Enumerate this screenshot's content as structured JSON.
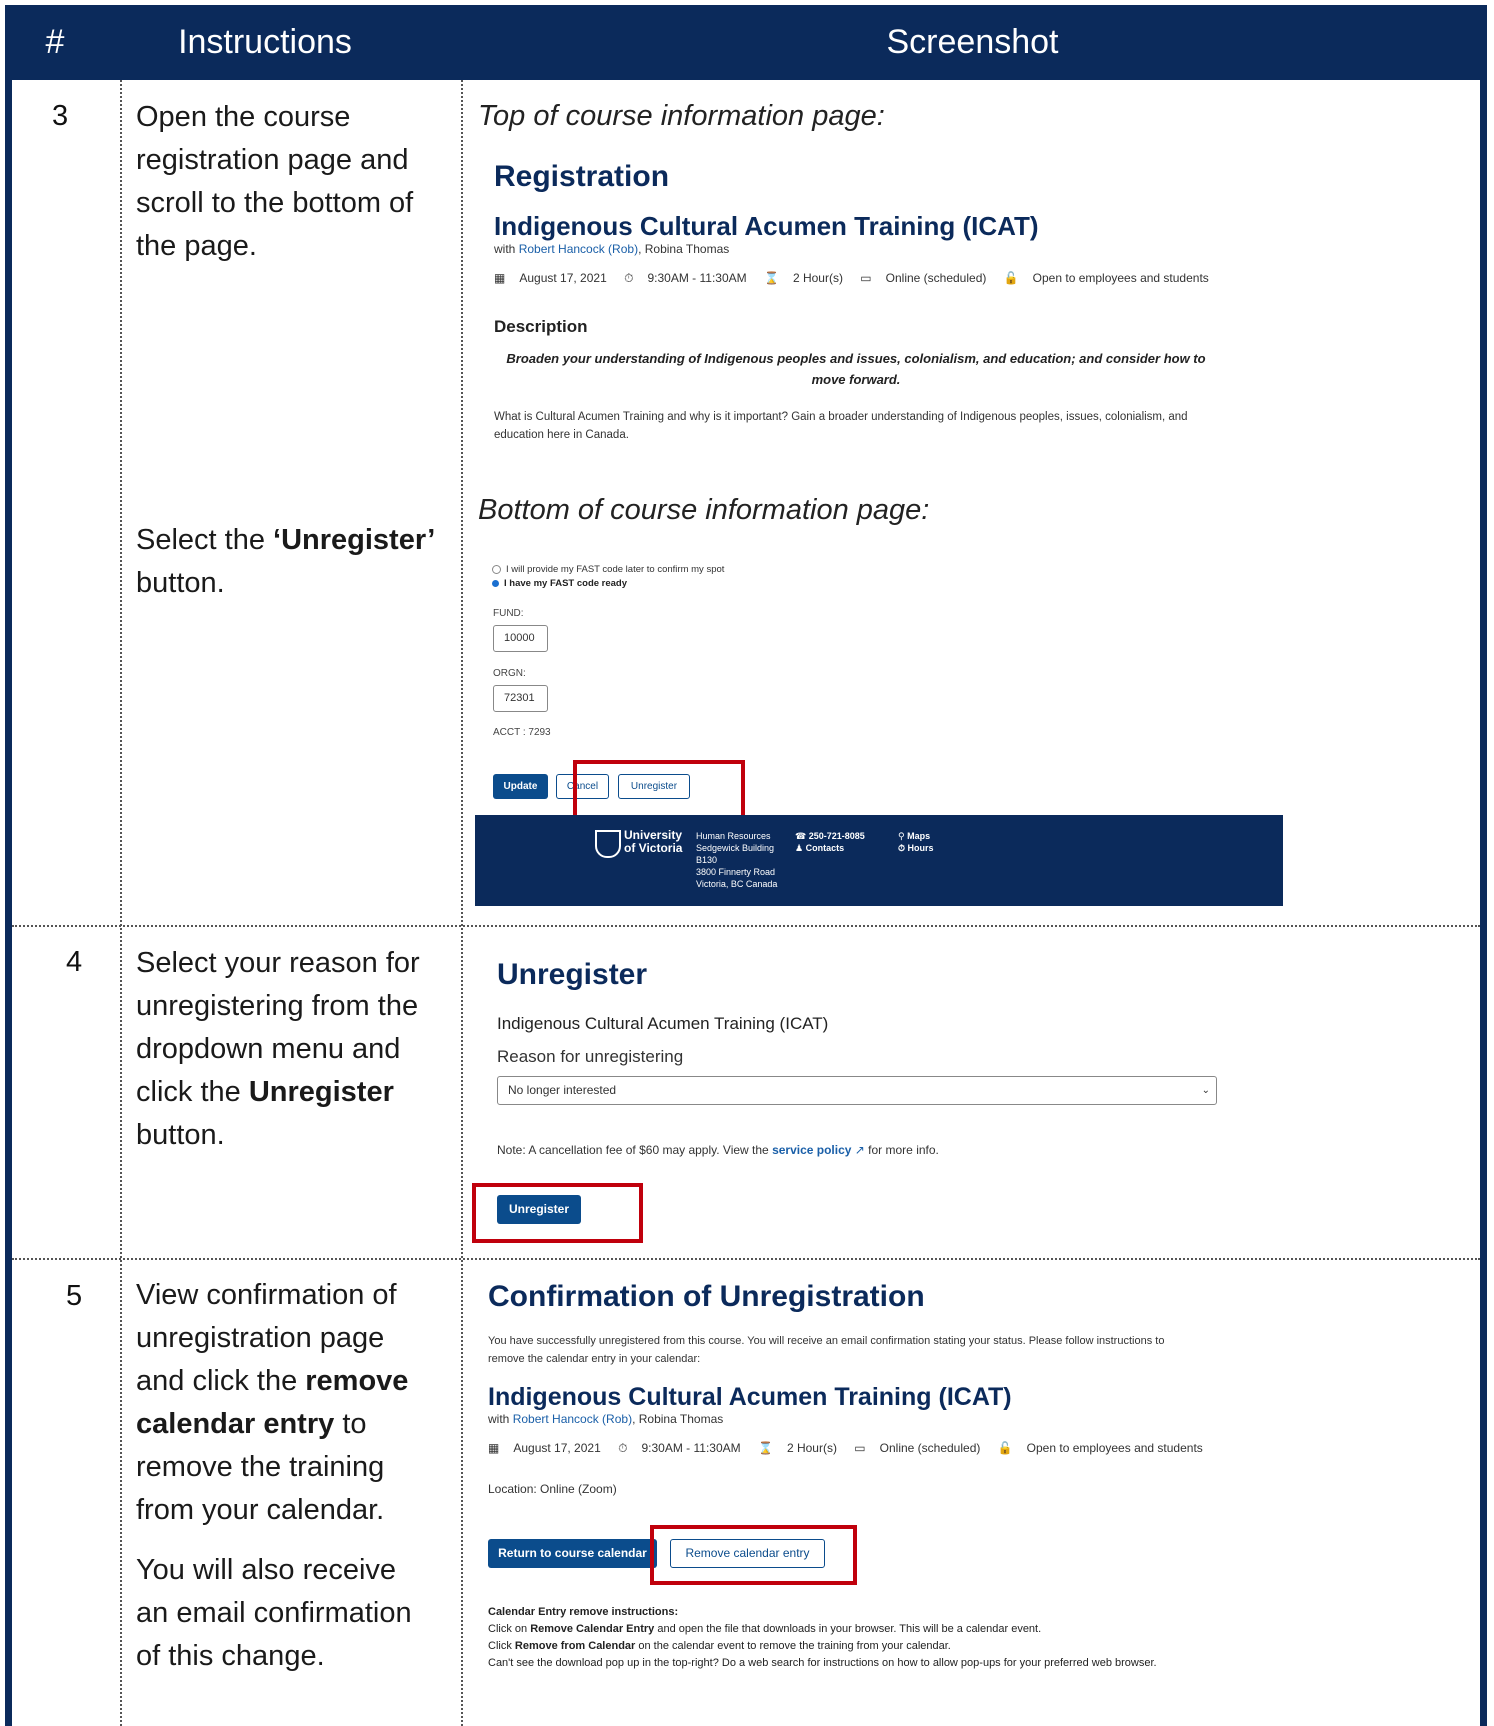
{
  "header": {
    "col_num": "#",
    "col_instructions": "Instructions",
    "col_screenshot": "Screenshot"
  },
  "step3": {
    "number": "3",
    "instr_a": "Open the course registration page and scroll to the bottom of the page.",
    "instr_b_pre": "Select the ",
    "instr_b_bold": "‘Unregister’",
    "instr_b_post": " button.",
    "caption_top": "Top of course information page:",
    "caption_bottom": "Bottom of course information page:",
    "reg_title": "Registration",
    "course_title": "Indigenous Cultural Acumen Training (ICAT)",
    "with_prefix": "with ",
    "with_link": "Robert Hancock (Rob)",
    "with_suffix": ", Robina Thomas",
    "date": "August 17, 2021",
    "time": "9:30AM - 11:30AM",
    "duration": "2 Hour(s)",
    "mode": "Online (scheduled)",
    "access": "Open to employees and students",
    "desc_heading": "Description",
    "desc_italic": "Broaden your understanding of Indigenous peoples and issues, colonialism, and education; and consider how to move forward.",
    "desc_body": "What is Cultural Acumen Training and why is it important? Gain a broader understanding of Indigenous peoples, issues, colonialism, and education here in Canada.",
    "radio_1": "I will provide my FAST code later to confirm my spot",
    "radio_2": "I have my FAST code ready",
    "fund_label": "FUND:",
    "fund_value": "10000",
    "orgn_label": "ORGN:",
    "orgn_value": "72301",
    "acct": "ACCT : 7293",
    "update_btn": "Update",
    "cancel_btn": "Cancel",
    "unregister_btn": "Unregister",
    "footer": {
      "uni_line1": "University",
      "uni_line2": "of Victoria",
      "addr": [
        "Human Resources",
        "Sedgewick Building",
        "B130",
        "3800 Finnerty Road",
        "Victoria, BC Canada"
      ],
      "phone": "250-721-8085",
      "contacts": "Contacts",
      "maps": "Maps",
      "hours": "Hours"
    }
  },
  "step4": {
    "number": "4",
    "instr_pre": "Select your reason for unregistering from the dropdown menu and click the ",
    "instr_bold": "Unregister",
    "instr_post": " button.",
    "title": "Unregister",
    "course": "Indigenous Cultural Acumen Training (ICAT)",
    "reason_label": "Reason for unregistering",
    "reason_value": "No longer interested",
    "note_pre": "Note: A cancellation fee of $60 may apply. View the ",
    "note_link": "service policy",
    "note_post": " for more info.",
    "button": "Unregister"
  },
  "step5": {
    "number": "5",
    "instr_pre": "View confirmation of unregistration page and click the ",
    "instr_bold": "remove calendar entry",
    "instr_post": " to remove the training from your calendar.",
    "instr_b": "You will also receive an email confirmation of this change.",
    "title": "Confirmation of Unregistration",
    "intro": "You have successfully unregistered from this course. You will receive an email confirmation stating your status. Please follow instructions to remove the calendar entry in your calendar:",
    "course": "Indigenous Cultural Acumen Training (ICAT)",
    "with_prefix": "with ",
    "with_link": "Robert Hancock (Rob)",
    "with_suffix": ", Robina Thomas",
    "date": "August 17, 2021",
    "time": "9:30AM - 11:30AM",
    "duration": "2 Hour(s)",
    "mode": "Online (scheduled)",
    "access": "Open to employees and students",
    "location": "Location: Online (Zoom)",
    "return_btn": "Return to course calendar",
    "remove_btn": "Remove calendar entry",
    "instr_heading": "Calendar Entry remove instructions:",
    "line1_pre": "Click on ",
    "line1_bold": "Remove Calendar Entry",
    "line1_post": " and open the file that downloads in your browser. This will be a calendar event.",
    "line2_pre": "Click ",
    "line2_bold": "Remove from Calendar",
    "line2_post": " on the calendar event to remove the training from your calendar.",
    "line3": "Can't see the download pop up in the top-right? Do a web search for instructions on how to allow pop-ups for your preferred web browser."
  }
}
